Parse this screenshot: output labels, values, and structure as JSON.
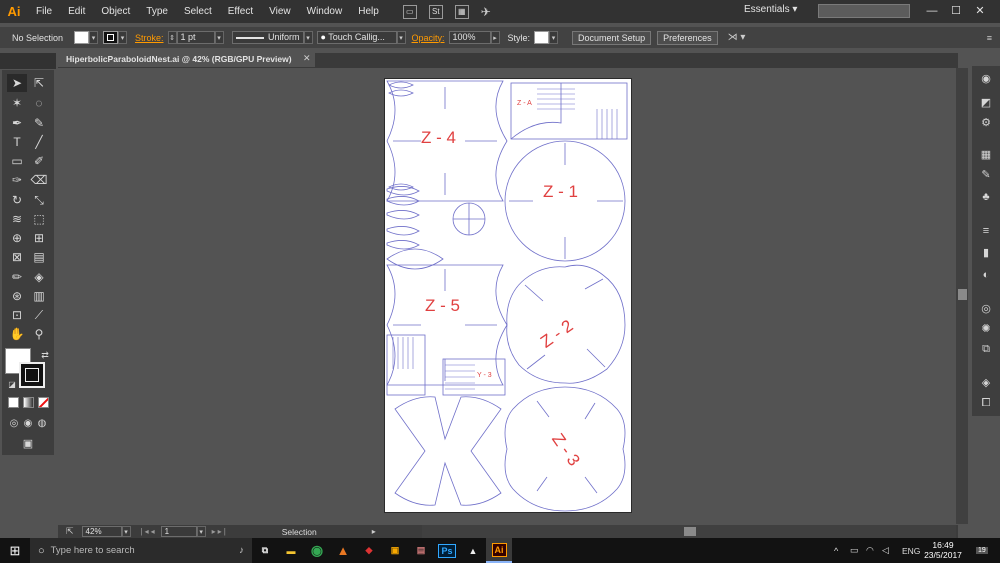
{
  "app": {
    "logo": "Ai"
  },
  "menu": {
    "items": [
      "File",
      "Edit",
      "Object",
      "Type",
      "Select",
      "Effect",
      "View",
      "Window",
      "Help"
    ]
  },
  "menubar": {
    "workspace": "Essentials",
    "win_min": "—",
    "win_max": "☐",
    "win_close": "✕"
  },
  "controlbar": {
    "selection": "No Selection",
    "stroke_label": "Stroke:",
    "stroke_weight": "1 pt",
    "stroke_profile": "Uniform",
    "brush": "Touch Callig...",
    "opacity_label": "Opacity:",
    "opacity_value": "100%",
    "style_label": "Style:",
    "document_setup": "Document Setup",
    "preferences": "Preferences"
  },
  "document": {
    "tab_title": "HiperbolicParaboloidNest.ai @ 42% (RGB/GPU Preview)"
  },
  "artboard": {
    "labels": [
      "Z - 4",
      "Z - 1",
      "Z - 5",
      "Z - 2",
      "Z - 3",
      "Z - A",
      "Y - 3"
    ],
    "line_color": "#6f6fc9",
    "text_color": "#e04040"
  },
  "statusbar": {
    "zoom": "42%",
    "page": "1",
    "mode": "Selection"
  },
  "taskbar": {
    "search_placeholder": "Type here to search",
    "lang": "ENG",
    "time": "16:49",
    "date": "23/5/2017",
    "notifications": "19",
    "apps": [
      "folder",
      "chrome",
      "matlab",
      "sketchup",
      "pdf",
      "photos",
      "Ps",
      "image",
      "Ai"
    ]
  },
  "colors": {
    "accent": "#ff9a00",
    "ps_blue": "#31a8ff"
  }
}
